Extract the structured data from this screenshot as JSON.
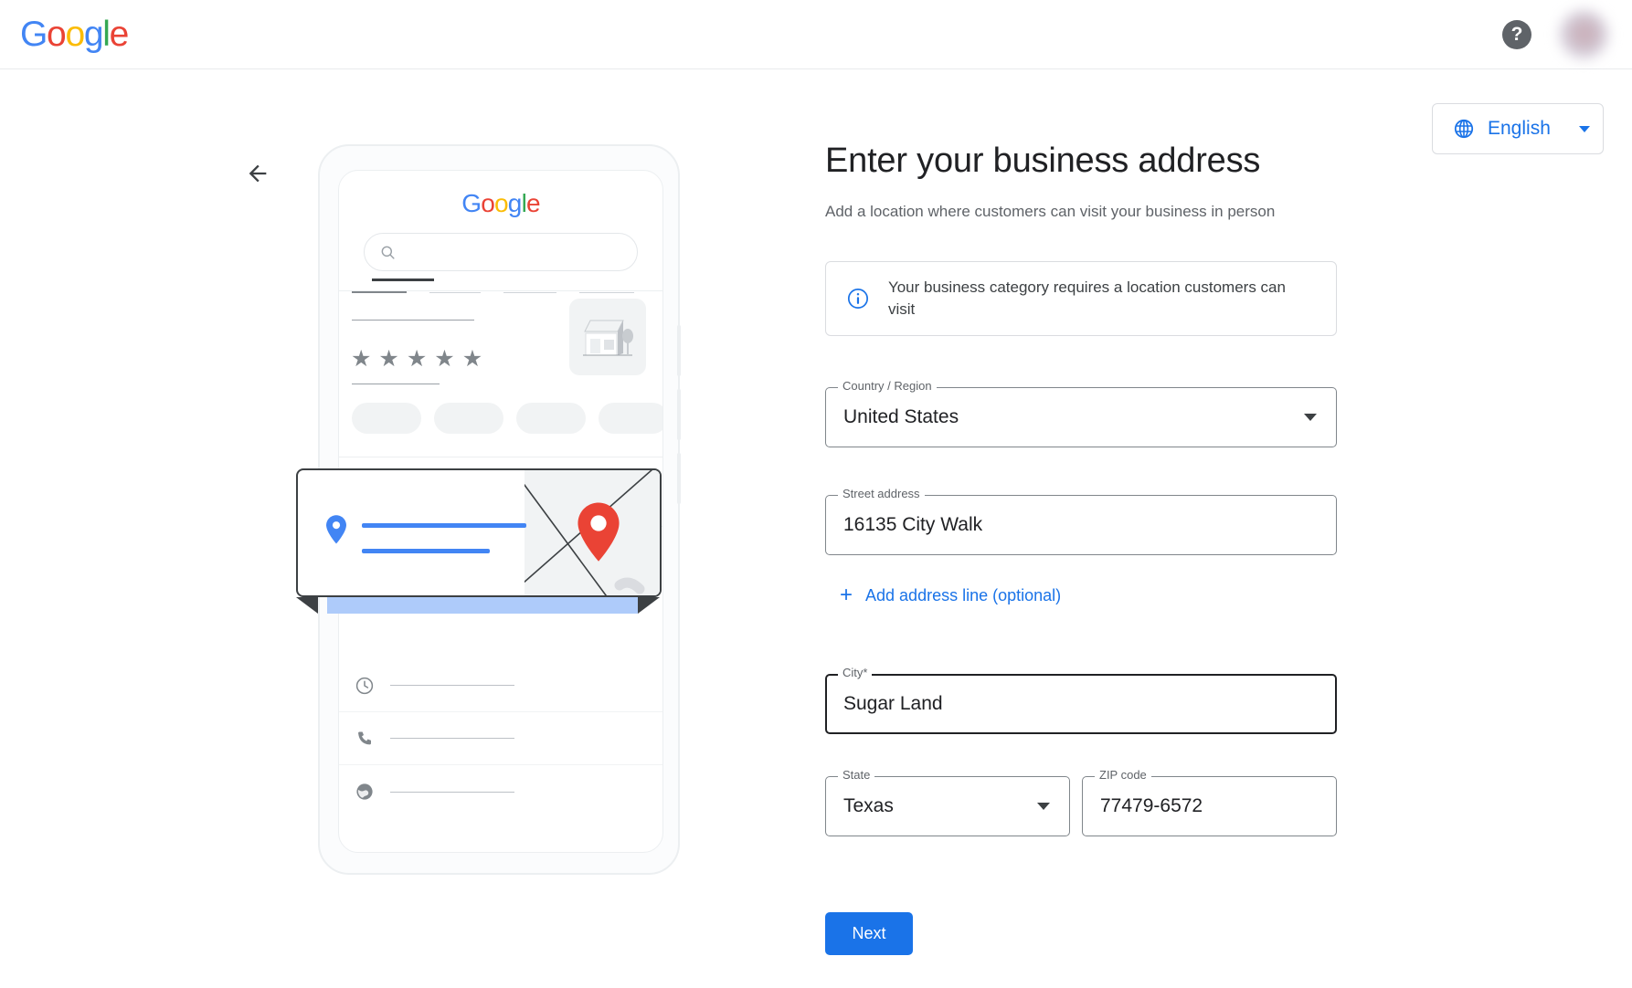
{
  "header": {
    "logo_text": "Google",
    "help_icon": "help-question-icon",
    "help_label": "?",
    "avatar_label": ""
  },
  "language_picker": {
    "icon": "globe-icon",
    "label": "English",
    "caret": "chevron-down-icon"
  },
  "back_button": {
    "icon": "arrow-back-icon"
  },
  "illustration": {
    "phone_logo_text": "Google",
    "search_icon": "search-icon",
    "star_glyph": "★",
    "star_count": 5,
    "storefront_icon": "storefront-thumbnail-icon",
    "action_icons": [
      "directions-icon",
      "phone-icon",
      "bookmark-icon",
      "share-icon"
    ],
    "info_row_icons": [
      "clock-icon",
      "phone-icon",
      "globe-icon"
    ],
    "overlay_card": {
      "pin_icon": "blue-map-pin-icon",
      "map_pin_icon": "red-map-pin-icon"
    }
  },
  "main": {
    "title": "Enter your business address",
    "subtitle": "Add a location where customers can visit your business in person",
    "info_banner": {
      "icon": "info-circle-icon",
      "text": "Your business category requires a location customers can visit"
    },
    "fields": {
      "country": {
        "label": "Country / Region",
        "value": "United States",
        "type": "select",
        "caret": "chevron-down-icon"
      },
      "street": {
        "label": "Street address",
        "value": "16135 City Walk",
        "type": "text",
        "placeholder": ""
      },
      "city": {
        "label": "City*",
        "value": "Sugar Land",
        "type": "text",
        "placeholder": ""
      },
      "state": {
        "label": "State",
        "value": "Texas",
        "type": "select",
        "caret": "chevron-down-icon"
      },
      "zip": {
        "label": "ZIP code",
        "value": "77479-6572",
        "type": "text",
        "placeholder": ""
      }
    },
    "add_address_line": {
      "icon": "plus-icon",
      "plus": "+",
      "label": "Add address line (optional)"
    },
    "next_button": "Next"
  },
  "colors": {
    "accent_blue": "#1a73e8",
    "google_blue": "#4285f4",
    "google_red": "#ea4335",
    "google_yellow": "#fbbc05",
    "google_green": "#34a853",
    "text_primary": "#202124",
    "text_secondary": "#5f6368",
    "border": "#dadce0"
  }
}
